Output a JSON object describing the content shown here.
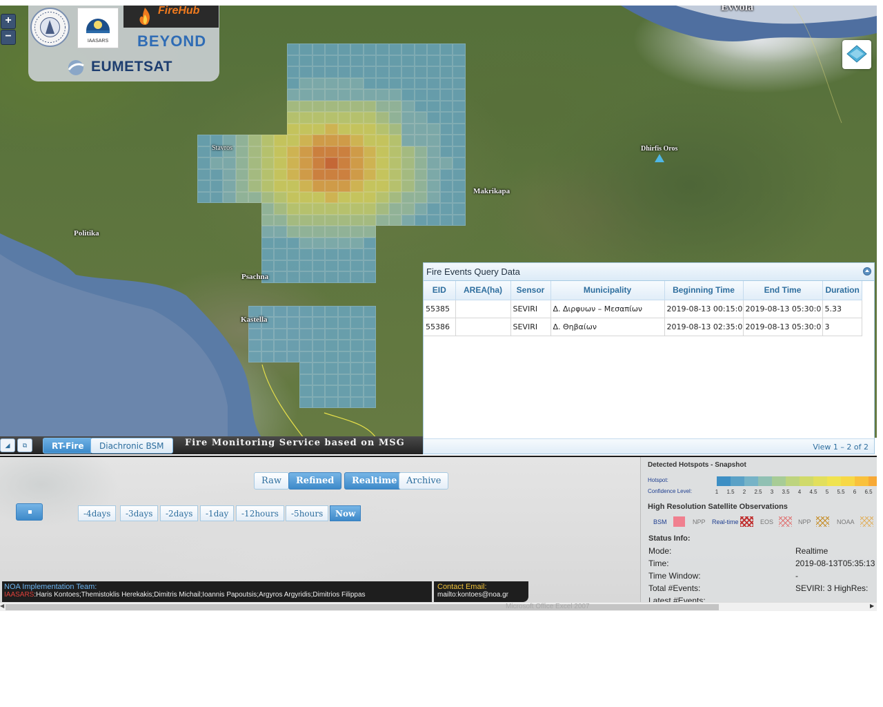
{
  "map": {
    "place_labels": [
      "Stavros",
      "Politika",
      "Psachna",
      "Kastella",
      "Makrikapa",
      "Dhirfis Oros",
      "Evvoia"
    ],
    "logos": [
      "IAASARS",
      "FireHub",
      "BEYOND",
      "EUMETSAT"
    ],
    "zoom_in": "+",
    "zoom_out": "−"
  },
  "query_panel": {
    "title": "Fire Events Query Data",
    "columns": [
      "EID",
      "AREA(ha)",
      "Sensor",
      "Municipality",
      "Beginning Time",
      "End Time",
      "Duration"
    ],
    "rows": [
      [
        "55385",
        "",
        "SEVIRI",
        "Δ. Διρφυων – Μεσαπίων",
        "2019-08-13 00:15:0",
        "2019-08-13 05:30:0",
        "5.33"
      ],
      [
        "55386",
        "",
        "SEVIRI",
        "Δ. Θηβαίων",
        "2019-08-13 02:35:0",
        "2019-08-13 05:30:0",
        "3"
      ]
    ],
    "pager": "View 1 – 2 of 2"
  },
  "tab_bar": {
    "tabs": [
      "RT-Fire",
      "Diachronic BSM"
    ],
    "service_title": "Fire Monitoring Service based on MSG"
  },
  "controls": {
    "data_buttons": [
      "Raw",
      "Refined",
      "Realtime",
      "Archive"
    ],
    "time_buttons": [
      "-4days",
      "-3days",
      "-2days",
      "-1day",
      "-12hours",
      "-5hours",
      "Now"
    ]
  },
  "footer": {
    "team_title": "NOA Implementation Team:",
    "team_org": "IAASARS",
    "team_members": ":Haris Kontoes;Themistoklis Herekakis;Dimitris Michail;Ioannis Papoutsis;Argyros Argyridis;Dimitrios Filippas",
    "contact_title": "Contact Email:",
    "contact_email": "mailto:kontoes@noa.gr"
  },
  "legend": {
    "hotspot_title": "Detected Hotspots - Snapshot",
    "hotspot_label": "Hotspot:",
    "confidence_label": "Confidence Level:",
    "confidence_levels": [
      "1",
      "1.5",
      "2",
      "2.5",
      "3",
      "3.5",
      "4",
      "4.5",
      "5",
      "5.5",
      "6",
      "6.5"
    ],
    "ramp_colors": [
      "#3d8fc4",
      "#5aa1c6",
      "#76b3c7",
      "#90c0b3",
      "#a7cc96",
      "#bdd47e",
      "#d0da6a",
      "#e2df5c",
      "#f0e350",
      "#f7d846",
      "#f9c13c",
      "#f7a936"
    ],
    "hires_title": "High Resolution Satellite Observations",
    "hires_items": [
      "BSM",
      "NPP",
      "Real-time",
      "EOS",
      "NPP",
      "NOAA"
    ],
    "status_title": "Status Info:",
    "status": [
      {
        "key": "Mode:",
        "value": "Realtime"
      },
      {
        "key": "Time:",
        "value": "2019-08-13T05:35:13"
      },
      {
        "key": "Time Window:",
        "value": "-"
      },
      {
        "key": "Total #Events:",
        "value": "SEVIRI: 3  HighRes:"
      },
      {
        "key": "Latest #Events:",
        "value": ""
      }
    ]
  },
  "scrollbar": {
    "tooltip": "Microsoft Office Excel 2007"
  }
}
